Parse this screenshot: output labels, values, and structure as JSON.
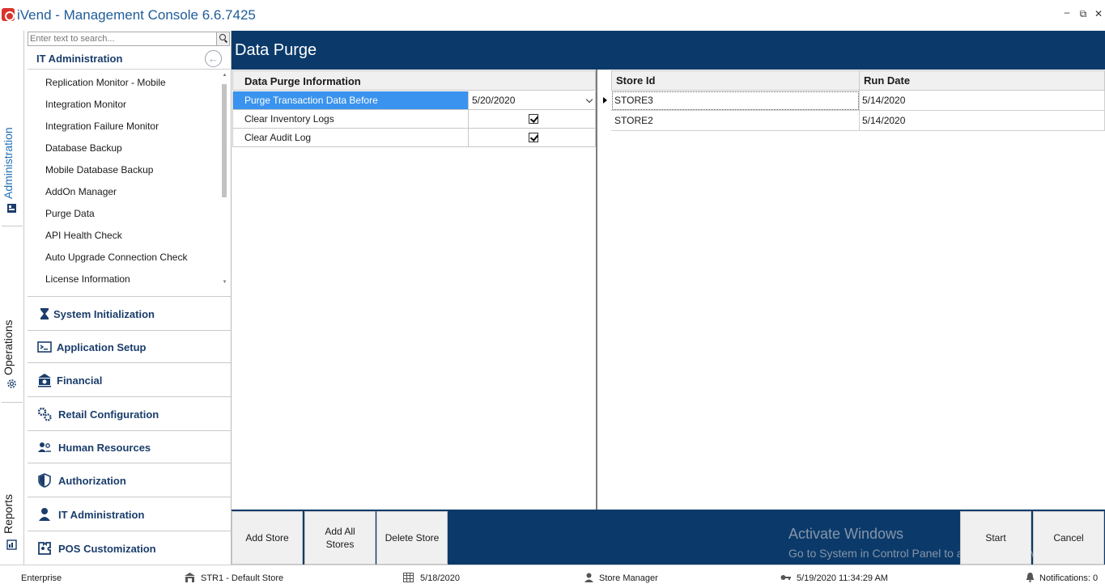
{
  "window": {
    "title": "iVend - Management Console  6.6.7425",
    "controls": [
      "minimize",
      "restore",
      "close"
    ]
  },
  "vtabs": [
    {
      "label": "Administration",
      "icon": "admin-icon",
      "active": true
    },
    {
      "label": "Operations",
      "icon": "gear-icon",
      "active": false
    },
    {
      "label": "Reports",
      "icon": "report-icon",
      "active": false
    }
  ],
  "nav": {
    "search_placeholder": "Enter text to search...",
    "section_title": "IT Administration",
    "items": [
      "Replication Monitor - Mobile",
      "Integration Monitor",
      "Integration Failure Monitor",
      "Database Backup",
      "Mobile Database Backup",
      "AddOn Manager",
      "Purge Data",
      "API Health Check",
      "Auto Upgrade Connection Check",
      "License Information"
    ],
    "groups": [
      {
        "label": "System Initialization",
        "icon": "hourglass-icon"
      },
      {
        "label": "Application Setup",
        "icon": "terminal-icon"
      },
      {
        "label": "Financial",
        "icon": "bank-icon"
      },
      {
        "label": "Retail Configuration",
        "icon": "gears-icon"
      },
      {
        "label": "Human Resources",
        "icon": "people-icon"
      },
      {
        "label": "Authorization",
        "icon": "shield-icon"
      },
      {
        "label": "IT Administration",
        "icon": "user-icon"
      },
      {
        "label": "POS Customization",
        "icon": "puzzle-icon"
      }
    ]
  },
  "page": {
    "title": "Data Purge"
  },
  "purge_info": {
    "header": "Data Purge Information",
    "rows": [
      {
        "label": "Purge Transaction Data Before",
        "value": "5/20/2020",
        "type": "date"
      },
      {
        "label": "Clear Inventory Logs",
        "checked": true,
        "type": "checkbox"
      },
      {
        "label": "Clear Audit Log",
        "checked": true,
        "type": "checkbox"
      }
    ]
  },
  "stores_grid": {
    "columns": [
      "Store Id",
      "Run Date"
    ],
    "rows": [
      {
        "store_id": "STORE3",
        "run_date": "5/14/2020"
      },
      {
        "store_id": "STORE2",
        "run_date": "5/14/2020"
      }
    ]
  },
  "actions": {
    "add_store": "Add Store",
    "add_all_stores": "Add All Stores",
    "delete_store": "Delete Store",
    "start": "Start",
    "cancel": "Cancel"
  },
  "watermark": {
    "title": "Activate Windows",
    "subtitle": "Go to System in Control Panel to activate Windows."
  },
  "status": {
    "edition": "Enterprise",
    "store": "STR1 - Default Store",
    "business_date": "5/18/2020",
    "role": "Store Manager",
    "login_time": "5/19/2020 11:34:29 AM",
    "notifications": "Notifications: 0"
  },
  "colors": {
    "header_bg": "#0b3a6a",
    "accent": "#1f6fb5",
    "selection": "#3a93ee"
  }
}
